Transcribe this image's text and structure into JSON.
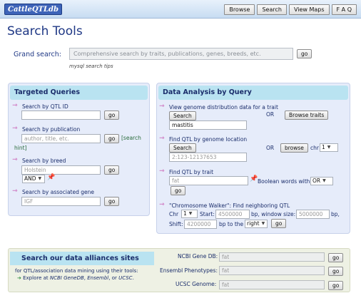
{
  "app": {
    "logo": "CattleQTLdb"
  },
  "nav": {
    "items": [
      "Browse",
      "Search",
      "View Maps",
      "F A Q"
    ]
  },
  "page": {
    "title": "Search Tools"
  },
  "grand": {
    "label": "Grand search:",
    "placeholder": "Comprehensive search by traits, publications, genes, breeds, etc.",
    "go": "go",
    "tips": "mysql search tips"
  },
  "targeted": {
    "title": "Targeted Queries",
    "qtl_id": {
      "label": "Search by QTL ID",
      "value": "",
      "go": "go"
    },
    "publication": {
      "label": "Search by publication",
      "placeholder": "author, title, etc.",
      "go": "go",
      "help_link": "[search hint]",
      "help_part1": "[search",
      "help_part2": "hint]"
    },
    "breed": {
      "label": "Search by breed",
      "placeholder": "Holstein",
      "go": "go",
      "logic": "AND"
    },
    "gene": {
      "label": "Search by associated gene",
      "placeholder": "IGF",
      "go": "go"
    }
  },
  "analysis": {
    "title": "Data Analysis by Query",
    "genome": {
      "label": "View genome distribution data for a trait",
      "search": "Search",
      "or": "OR",
      "browse": "Browse traits",
      "value": "mastitis"
    },
    "location": {
      "label": "Find QTL by genome location",
      "search": "Search",
      "or": "OR",
      "browse": "browse",
      "chr_label": "chr",
      "chr": "1",
      "placeholder": "2:123-12137653"
    },
    "trait": {
      "label": "Find QTL by trait",
      "placeholder": "fat",
      "boolean_label": "Boolean words with",
      "boolean": "OR",
      "go": "go"
    },
    "walker": {
      "label": "\"Chromosome Walker\": Find neighboring QTL",
      "chr_label": "Chr",
      "chr": "1",
      "start_label": "Start:",
      "start": "4500000",
      "window_label": "bp, window size:",
      "window": "5000000",
      "bp": "bp,",
      "shift_label": "Shift:",
      "shift": "4200000",
      "to_label": "bp to the",
      "direction": "right",
      "go": "go"
    }
  },
  "alliance": {
    "title": "Search our data alliances sites",
    "desc": "for QTL/association data mining using their tools:",
    "explore_prefix": "Explore at ",
    "ncbi_link": "NCBI GeneDB",
    "sep1": ", ",
    "ensembl_link": "Ensembl",
    "sep2": ", or ",
    "ucsc_link": "UCSC",
    "end": ".",
    "fields": [
      {
        "label": "NCBI Gene DB:",
        "value": "fat",
        "go": "go"
      },
      {
        "label": "Ensembl Phenotypes:",
        "value": "fat",
        "go": "go"
      },
      {
        "label": "UCSC Genome:",
        "value": "fat",
        "go": "go"
      }
    ]
  },
  "colors": {
    "panel_bg": "#e6ecfa",
    "panel_head": "#b9e3f1",
    "arrow": "#c23aa3",
    "title": "#1f3885"
  }
}
